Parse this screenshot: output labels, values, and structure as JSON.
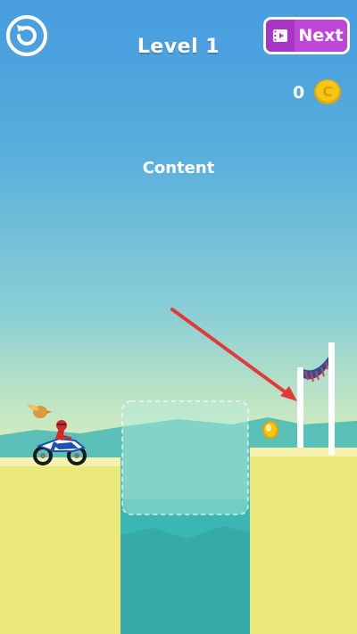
{
  "hud": {
    "level_title": "Level 1",
    "next_label": "Next",
    "coin_count": "0",
    "coin_symbol": "C"
  },
  "scene": {
    "content_label": "Content"
  },
  "colors": {
    "sky_top": "#3f9bdc",
    "ground": "#ebe97b",
    "water": "#3bb7b3",
    "next_button": "#c046d8",
    "arrow": "#e23a3a",
    "coin": "#f5c518"
  },
  "icons": [
    "restart-icon",
    "video-icon",
    "coin-icon",
    "arrow-pointer",
    "finish-gate",
    "motorbike-rider",
    "bird"
  ]
}
